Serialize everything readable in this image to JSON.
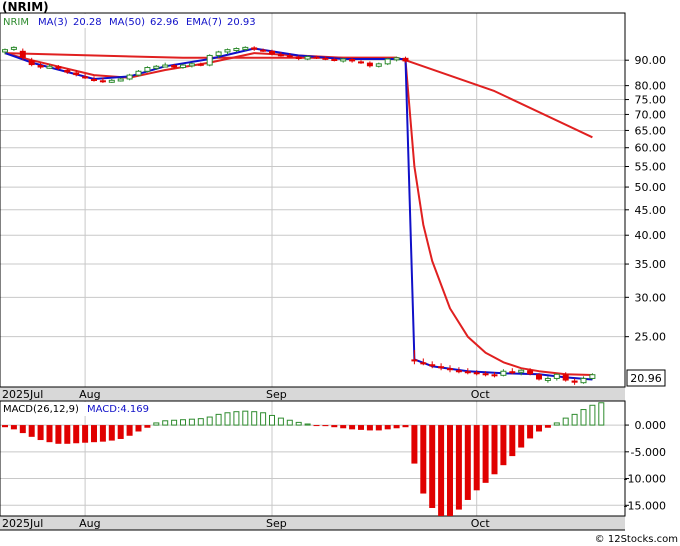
{
  "chart_data": [
    {
      "type": "candlestick",
      "title": "(NRIM)",
      "legend_items": [
        {
          "label": "NRIM",
          "value": "",
          "color": "#2e8b2e"
        },
        {
          "label": "MA(3)",
          "value": "20.28",
          "color": "#1010c8"
        },
        {
          "label": "MA(50)",
          "value": "62.96",
          "color": "#1010c8"
        },
        {
          "label": "EMA(7)",
          "value": "20.93",
          "color": "#1010c8"
        }
      ],
      "price_ticks": [
        "90.00",
        "80.00",
        "75.00",
        "70.00",
        "65.00",
        "60.00",
        "55.00",
        "50.00",
        "45.00",
        "40.00",
        "35.00",
        "30.00",
        "25.00"
      ],
      "last_price_label": "20.96",
      "y_scale": "log",
      "ylim": [
        19.8,
        112
      ],
      "x_labels": [
        {
          "label": "2025Jul",
          "i": 0
        },
        {
          "label": "Aug",
          "i": 9
        },
        {
          "label": "Sep",
          "i": 30
        },
        {
          "label": "Oct",
          "i": 53
        }
      ],
      "n_days": 70,
      "candles": [
        [
          0,
          93.5,
          95,
          92.5,
          94.5
        ],
        [
          1,
          95,
          96,
          94,
          95.5
        ],
        [
          2,
          94,
          95,
          90,
          91
        ],
        [
          3,
          90,
          91,
          87.5,
          88
        ],
        [
          4,
          88,
          89,
          86.5,
          87
        ],
        [
          5,
          87,
          88.5,
          86.5,
          87.5
        ],
        [
          6,
          87.5,
          88,
          86,
          86.5
        ],
        [
          7,
          86,
          86.5,
          84.5,
          85
        ],
        [
          8,
          85,
          86,
          83.5,
          84
        ],
        [
          9,
          83.5,
          84.5,
          82.5,
          83
        ],
        [
          10,
          82.5,
          83.5,
          81.5,
          82
        ],
        [
          11,
          82,
          83,
          81,
          81.5
        ],
        [
          12,
          81.5,
          82.5,
          81,
          82
        ],
        [
          13,
          82,
          83,
          81.5,
          82.5
        ],
        [
          14,
          82.5,
          84.5,
          82,
          84
        ],
        [
          15,
          84,
          86,
          83.5,
          85.5
        ],
        [
          16,
          85.5,
          87.5,
          85,
          87
        ],
        [
          17,
          87,
          88,
          86,
          87.5
        ],
        [
          18,
          87.5,
          89,
          87,
          88
        ],
        [
          19,
          88,
          88.5,
          86.5,
          87
        ],
        [
          20,
          87,
          88.5,
          86.5,
          88
        ],
        [
          21,
          88,
          89,
          87,
          88.5
        ],
        [
          22,
          88.5,
          89,
          87.5,
          88
        ],
        [
          23,
          88,
          92.5,
          87.5,
          92
        ],
        [
          24,
          92,
          94,
          91,
          93.5
        ],
        [
          25,
          93.5,
          95,
          92.5,
          94.5
        ],
        [
          26,
          94.5,
          95.5,
          93.5,
          95
        ],
        [
          27,
          95,
          96,
          94,
          95.5
        ],
        [
          28,
          95.5,
          96,
          94,
          94.5
        ],
        [
          29,
          94.5,
          95,
          93.5,
          94
        ],
        [
          30,
          94,
          94.5,
          92,
          92.5
        ],
        [
          31,
          92.5,
          93.5,
          91.5,
          92
        ],
        [
          32,
          92,
          93,
          91,
          91.5
        ],
        [
          33,
          91.5,
          92,
          90,
          90.5
        ],
        [
          34,
          90.5,
          92,
          90,
          91.5
        ],
        [
          35,
          91.5,
          92,
          90.5,
          91
        ],
        [
          36,
          91,
          91.5,
          90,
          90.5
        ],
        [
          37,
          90.5,
          91,
          89.5,
          90
        ],
        [
          38,
          90,
          91,
          89,
          90.5
        ],
        [
          39,
          90.5,
          91,
          89,
          89.5
        ],
        [
          40,
          89.5,
          90,
          88.5,
          89
        ],
        [
          41,
          89,
          89.5,
          87,
          87.5
        ],
        [
          42,
          87.5,
          89,
          87,
          88.5
        ],
        [
          43,
          88.5,
          91,
          88,
          90.5
        ],
        [
          44,
          90.5,
          91.5,
          89.5,
          91
        ],
        [
          45,
          91,
          91.5,
          89,
          89.5
        ],
        [
          46,
          22.5,
          23.5,
          22,
          22.3
        ],
        [
          47,
          22.2,
          22.6,
          21.9,
          22
        ],
        [
          48,
          22,
          22.3,
          21.6,
          21.8
        ],
        [
          49,
          21.8,
          22.1,
          21.4,
          21.6
        ],
        [
          50,
          21.6,
          21.9,
          21.2,
          21.4
        ],
        [
          51,
          21.4,
          21.7,
          21.1,
          21.3
        ],
        [
          52,
          21.3,
          21.6,
          21,
          21.2
        ],
        [
          53,
          21.2,
          21.4,
          20.9,
          21.1
        ],
        [
          54,
          21.1,
          21.3,
          20.8,
          21
        ],
        [
          55,
          21,
          21.2,
          20.7,
          20.9
        ],
        [
          56,
          20.9,
          21.5,
          20.8,
          21.3
        ],
        [
          57,
          21.3,
          21.6,
          21,
          21.2
        ],
        [
          58,
          21.2,
          21.5,
          20.9,
          21.4
        ],
        [
          59,
          21.4,
          21.6,
          20.9,
          21
        ],
        [
          60,
          21,
          21.1,
          20.4,
          20.5
        ],
        [
          61,
          20.5,
          20.8,
          20.2,
          20.6
        ],
        [
          62,
          20.6,
          21.1,
          20.4,
          21
        ],
        [
          63,
          21,
          21.2,
          20.3,
          20.4
        ],
        [
          64,
          20.4,
          20.6,
          20,
          20.2
        ],
        [
          65,
          20.2,
          20.8,
          20.1,
          20.6
        ],
        [
          66,
          20.6,
          21.1,
          20.5,
          20.96
        ]
      ],
      "ma50_line": [
        [
          0,
          93
        ],
        [
          20,
          91
        ],
        [
          44,
          91
        ],
        [
          45,
          90
        ],
        [
          55,
          78
        ],
        [
          66,
          62.96
        ]
      ],
      "ma3_line": [
        [
          0,
          93
        ],
        [
          3,
          89
        ],
        [
          10,
          82.5
        ],
        [
          14,
          83.5
        ],
        [
          18,
          87.5
        ],
        [
          23,
          90.5
        ],
        [
          28,
          95
        ],
        [
          33,
          92
        ],
        [
          38,
          90.5
        ],
        [
          44,
          90.5
        ],
        [
          45,
          90.5
        ],
        [
          46,
          22.5
        ],
        [
          48,
          21.8
        ],
        [
          52,
          21.3
        ],
        [
          56,
          21.1
        ],
        [
          60,
          21
        ],
        [
          63,
          20.7
        ],
        [
          66,
          20.5
        ]
      ],
      "ema7_line": [
        [
          0,
          93
        ],
        [
          3,
          90
        ],
        [
          10,
          84
        ],
        [
          14,
          83
        ],
        [
          18,
          86
        ],
        [
          23,
          89
        ],
        [
          28,
          93
        ],
        [
          33,
          92
        ],
        [
          38,
          91
        ],
        [
          44,
          91
        ],
        [
          45,
          90
        ],
        [
          46,
          55
        ],
        [
          47,
          42
        ],
        [
          48,
          35.5
        ],
        [
          50,
          28.5
        ],
        [
          52,
          25
        ],
        [
          54,
          23.2
        ],
        [
          56,
          22.2
        ],
        [
          58,
          21.6
        ],
        [
          60,
          21.3
        ],
        [
          63,
          21
        ],
        [
          66,
          20.93
        ]
      ]
    },
    {
      "type": "bar",
      "title": "MACD(26,12,9)",
      "value_label": "MACD:4.169",
      "y_ticks": [
        "0.000",
        "-5.000",
        "-10.000",
        "-15.000"
      ],
      "ylim": [
        -17000,
        4500
      ],
      "x_labels": [
        {
          "label": "2025Jul",
          "i": 0
        },
        {
          "label": "Aug",
          "i": 9
        },
        {
          "label": "Sep",
          "i": 30
        },
        {
          "label": "Oct",
          "i": 53
        }
      ],
      "histogram": [
        [
          0,
          -400
        ],
        [
          1,
          -800
        ],
        [
          2,
          -1500
        ],
        [
          3,
          -2200
        ],
        [
          4,
          -2800
        ],
        [
          5,
          -3200
        ],
        [
          6,
          -3500
        ],
        [
          7,
          -3500
        ],
        [
          8,
          -3400
        ],
        [
          9,
          -3300
        ],
        [
          10,
          -3200
        ],
        [
          11,
          -3100
        ],
        [
          12,
          -2900
        ],
        [
          13,
          -2600
        ],
        [
          14,
          -2000
        ],
        [
          15,
          -1200
        ],
        [
          16,
          -500
        ],
        [
          17,
          400
        ],
        [
          18,
          800
        ],
        [
          19,
          900
        ],
        [
          20,
          1000
        ],
        [
          21,
          1100
        ],
        [
          22,
          1200
        ],
        [
          23,
          1500
        ],
        [
          24,
          2000
        ],
        [
          25,
          2300
        ],
        [
          26,
          2500
        ],
        [
          27,
          2600
        ],
        [
          28,
          2500
        ],
        [
          29,
          2300
        ],
        [
          30,
          1800
        ],
        [
          31,
          1300
        ],
        [
          32,
          900
        ],
        [
          33,
          500
        ],
        [
          34,
          200
        ],
        [
          35,
          -100
        ],
        [
          36,
          -200
        ],
        [
          37,
          -400
        ],
        [
          38,
          -600
        ],
        [
          39,
          -800
        ],
        [
          40,
          -900
        ],
        [
          41,
          -1000
        ],
        [
          42,
          -1000
        ],
        [
          43,
          -800
        ],
        [
          44,
          -600
        ],
        [
          45,
          -400
        ],
        [
          46,
          -7200
        ],
        [
          47,
          -12800
        ],
        [
          48,
          -15500
        ],
        [
          49,
          -17000
        ],
        [
          50,
          -17000
        ],
        [
          51,
          -15800
        ],
        [
          52,
          -14000
        ],
        [
          53,
          -12200
        ],
        [
          54,
          -10800
        ],
        [
          55,
          -9200
        ],
        [
          56,
          -7500
        ],
        [
          57,
          -5800
        ],
        [
          58,
          -4200
        ],
        [
          59,
          -2500
        ],
        [
          60,
          -1200
        ],
        [
          61,
          -500
        ],
        [
          62,
          400
        ],
        [
          63,
          1300
        ],
        [
          64,
          2000
        ],
        [
          65,
          2900
        ],
        [
          66,
          3700
        ],
        [
          67,
          4169
        ]
      ]
    }
  ],
  "watermark": "© 12Stocks.com",
  "colors": {
    "up_candle": "#2e8b2e",
    "down_candle": "#e00000",
    "ma_blue": "#1010c8",
    "ema_red": "#e02020",
    "grid": "#c8c8c8",
    "axis_band": "#d8d8d8"
  }
}
